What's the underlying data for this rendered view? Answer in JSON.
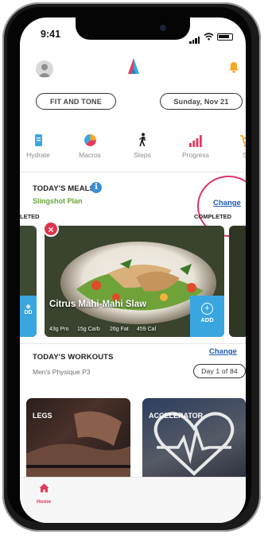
{
  "status_bar": {
    "time": "9:41"
  },
  "header": {
    "goal": "FIT AND TONE",
    "date": "Sunday, Nov 21"
  },
  "quick_actions": [
    {
      "label": "Hydrate",
      "icon": "hydrate-icon"
    },
    {
      "label": "Macros",
      "icon": "macros-pie-icon"
    },
    {
      "label": "Steps",
      "icon": "steps-walker-icon"
    },
    {
      "label": "Progress",
      "icon": "progress-bars-icon"
    },
    {
      "label": "Sh",
      "icon": "shop-cart-icon"
    }
  ],
  "meals": {
    "title": "TODAY'S MEALS",
    "plan": "Slingshot Plan",
    "change_label": "Change",
    "left_label": "LETED",
    "right_label": "COMPLETED",
    "card": {
      "name": "Citrus Mahi-Mahi Slaw",
      "pro": "43g Pro",
      "carb": "15g Carb",
      "fat": "26g Fat",
      "cal": "459 Cal",
      "add_label": "ADD"
    },
    "left_add_label": "DD"
  },
  "workouts": {
    "title": "TODAY'S WORKOUTS",
    "change_label": "Change",
    "program": "Men's Physique P3",
    "day": "Day 1 of 84",
    "cards": [
      {
        "label": "LEGS"
      },
      {
        "label": "ACCELERATOR"
      }
    ]
  },
  "tabbar": {
    "active_label": "Home",
    "items": [
      "Home",
      "",
      "",
      "",
      ""
    ]
  },
  "colors": {
    "accent": "#e3395a",
    "link": "#1f5bb3",
    "plan": "#6aa33a",
    "add": "#3aa6e0",
    "bell": "#f5a623"
  }
}
